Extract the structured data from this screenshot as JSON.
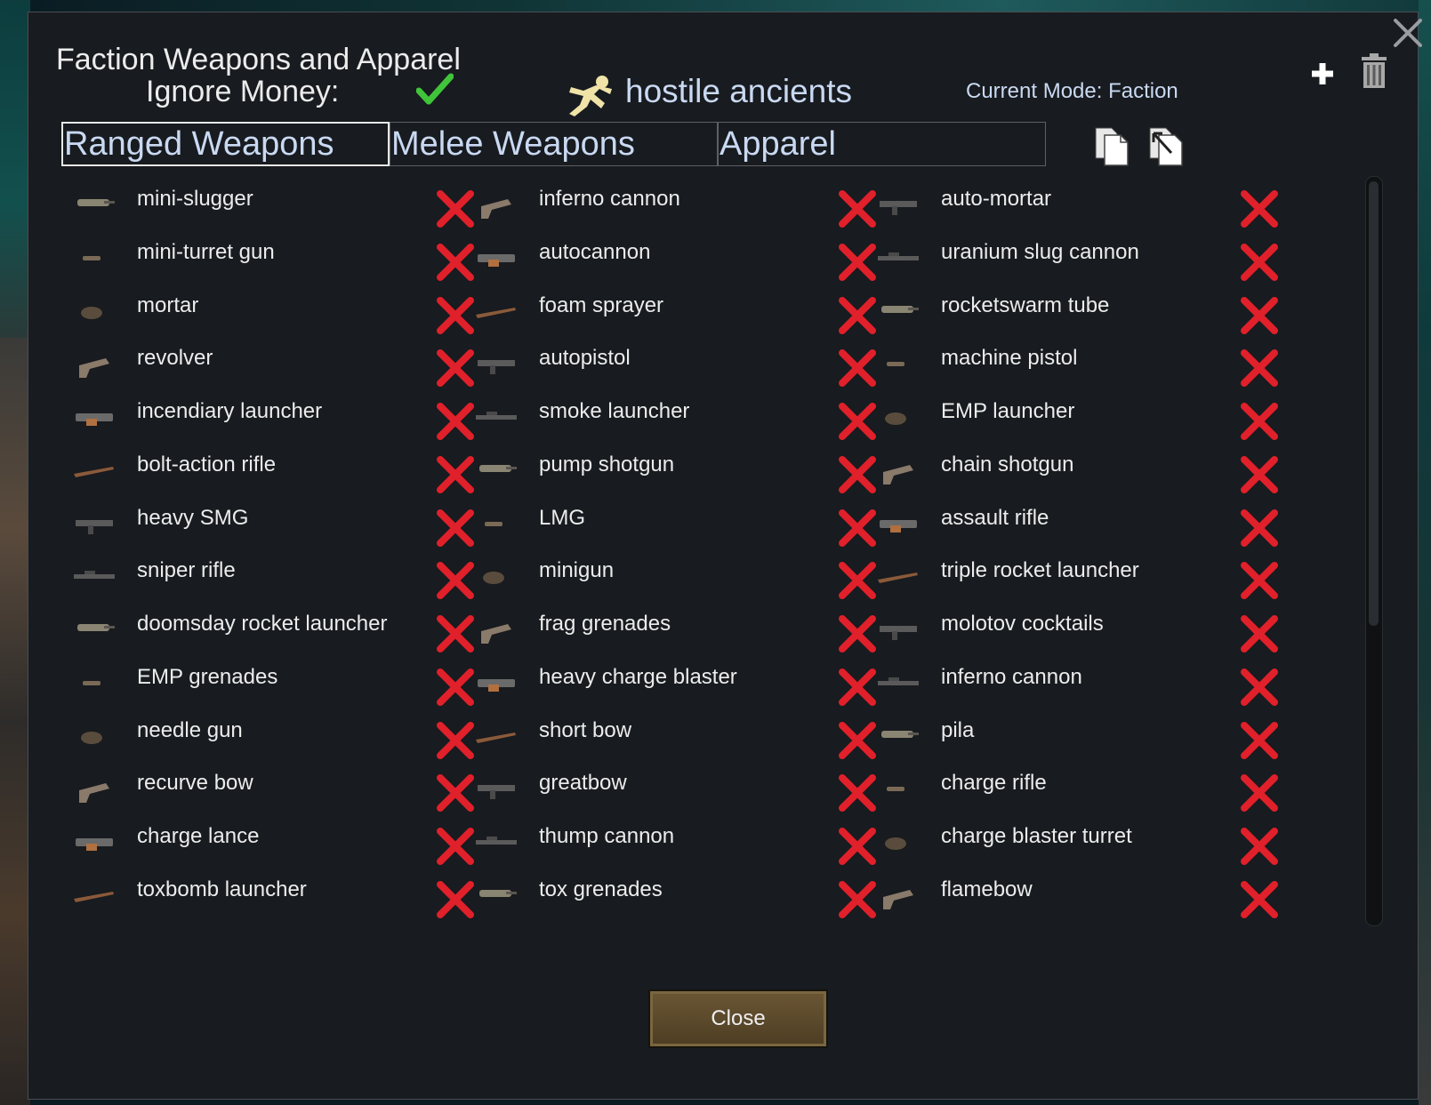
{
  "window": {
    "title": "Faction Weapons and Apparel",
    "ignore_money_label": "Ignore Money:",
    "faction_name": "hostile ancients",
    "current_mode": "Current Mode: Faction"
  },
  "tabs": [
    {
      "label": "Ranged Weapons",
      "active": true
    },
    {
      "label": "Melee Weapons",
      "active": false
    },
    {
      "label": "Apparel",
      "active": false
    }
  ],
  "columns": [
    [
      "mini-slugger",
      "mini-turret gun",
      "mortar",
      "revolver",
      "incendiary launcher",
      "bolt-action rifle",
      "heavy SMG",
      "sniper rifle",
      "doomsday rocket launcher",
      "EMP grenades",
      "needle gun",
      "recurve bow",
      "charge lance",
      "toxbomb launcher"
    ],
    [
      "inferno cannon",
      "autocannon",
      "foam sprayer",
      "autopistol",
      "smoke launcher",
      "pump shotgun",
      "LMG",
      "minigun",
      "frag grenades",
      "heavy charge blaster",
      "short bow",
      "greatbow",
      "thump cannon",
      "tox grenades"
    ],
    [
      "auto-mortar",
      "uranium slug cannon",
      "rocketswarm tube",
      "machine pistol",
      "EMP launcher",
      "chain shotgun",
      "assault rifle",
      "triple rocket launcher",
      "molotov cocktails",
      "inferno cannon",
      "pila",
      "charge rifle",
      "charge blaster turret",
      "flamebow"
    ]
  ],
  "buttons": {
    "close_label": "Close"
  },
  "colors": {
    "accent_text": "#c9d9f2",
    "remove_red": "#e0202a",
    "check_green": "#3fc43a",
    "button_gold": "#5c4a2c"
  },
  "icons": {
    "close": "close-x-icon",
    "add": "plus-icon",
    "delete": "trash-icon",
    "copy": "copy-icon",
    "paste": "paste-icon",
    "check": "checkmark-icon",
    "faction": "fleeing-person-icon",
    "remove": "red-x-icon"
  }
}
